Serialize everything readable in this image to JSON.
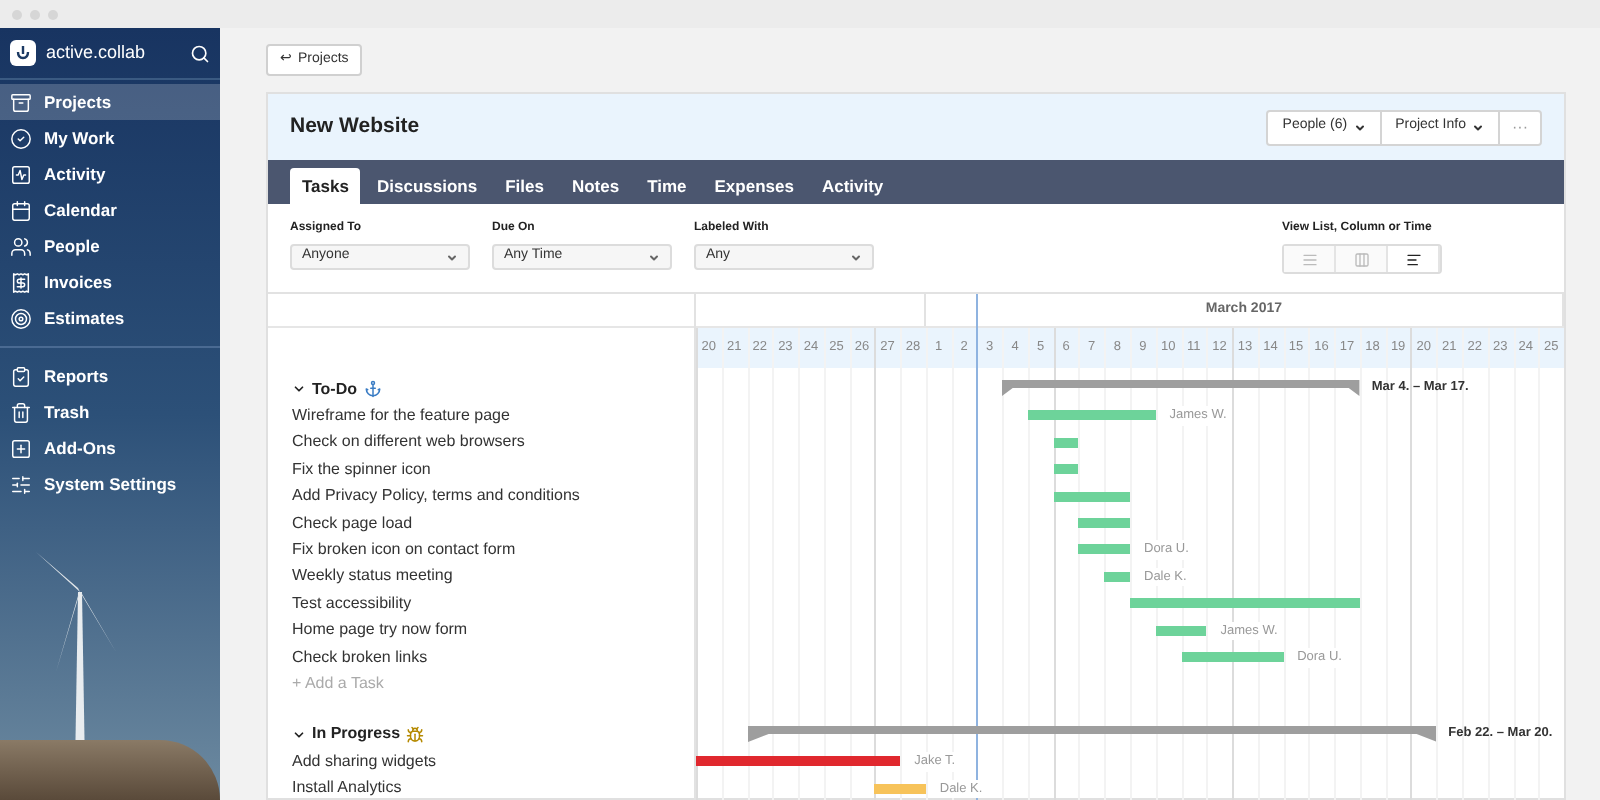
{
  "sidebar": {
    "brand": "active.collab",
    "groups": [
      {
        "items": [
          {
            "label": "Projects",
            "selected": true
          },
          {
            "label": "My Work",
            "selected": false
          },
          {
            "label": "Activity",
            "selected": false
          },
          {
            "label": "Calendar",
            "selected": false
          },
          {
            "label": "People",
            "selected": false
          },
          {
            "label": "Invoices",
            "selected": false
          },
          {
            "label": "Estimates",
            "selected": false
          }
        ]
      },
      {
        "items": [
          {
            "label": "Reports",
            "selected": false
          },
          {
            "label": "Trash",
            "selected": false
          },
          {
            "label": "Add-Ons",
            "selected": false
          },
          {
            "label": "System Settings",
            "selected": false
          }
        ]
      }
    ]
  },
  "back_button": {
    "icon": "↩",
    "label": "Projects"
  },
  "project": {
    "title": "New Website",
    "buttons": [
      "People (6)",
      "Project Info"
    ],
    "more": "···"
  },
  "tabs": [
    {
      "label": "Tasks",
      "selected": true
    },
    {
      "label": "Discussions",
      "selected": false
    },
    {
      "label": "Files",
      "selected": false
    },
    {
      "label": "Notes",
      "selected": false
    },
    {
      "label": "Time",
      "selected": false
    },
    {
      "label": "Expenses",
      "selected": false
    },
    {
      "label": "Activity",
      "selected": false
    }
  ],
  "filters": [
    {
      "label": "Assigned To",
      "value": "Anyone"
    },
    {
      "label": "Due On",
      "value": "Any Time"
    },
    {
      "label": "Labeled With",
      "value": "Any"
    }
  ],
  "view_switch": {
    "label": "View List, Column or Time",
    "options": [
      {
        "kind": "list",
        "selected": false
      },
      {
        "kind": "column",
        "selected": false
      },
      {
        "kind": "time",
        "selected": true
      }
    ]
  },
  "timeline": {
    "months": [
      {
        "days": [
          "20",
          "21",
          "22",
          "23",
          "24",
          "25",
          "26",
          "27",
          "28"
        ]
      },
      {
        "label": "March 2017",
        "days": [
          "1",
          "2",
          "3",
          "4",
          "5",
          "6",
          "7",
          "8",
          "9",
          "10",
          "11",
          "12",
          "13",
          "14",
          "15",
          "16",
          "17",
          "18",
          "19",
          "20",
          "21",
          "22",
          "23",
          "24",
          "25"
        ]
      }
    ]
  },
  "task_lists": [
    {
      "name": "To-Do",
      "kind": "anchor",
      "range": "Mar 4. – Mar 17.",
      "add_task": "+ Add a Task",
      "tasks": [
        {
          "name": "Wireframe for the feature page",
          "assignee": "James W.",
          "color": "#6dd39a"
        },
        {
          "name": "Check on different web browsers",
          "color": "#6dd39a"
        },
        {
          "name": "Fix the spinner icon",
          "color": "#6dd39a"
        },
        {
          "name": "Add Privacy Policy, terms and conditions",
          "color": "#6dd39a"
        },
        {
          "name": "Check page load",
          "color": "#6dd39a"
        },
        {
          "name": "Fix broken icon on contact form",
          "assignee": "Dora U.",
          "color": "#6dd39a"
        },
        {
          "name": "Weekly status meeting",
          "assignee": "Dale K.",
          "color": "#6dd39a"
        },
        {
          "name": "Test accessibility",
          "color": "#6dd39a"
        },
        {
          "name": "Home page try now form",
          "assignee": "James W.",
          "color": "#6dd39a"
        },
        {
          "name": "Check broken links",
          "assignee": "Dora U.",
          "color": "#6dd39a"
        }
      ]
    },
    {
      "name": "In Progress",
      "kind": "bee",
      "range": "Feb 22. – Mar 20.",
      "tasks": [
        {
          "name": "Add sharing widgets",
          "assignee": "Jake T.",
          "color": "#e0282e"
        },
        {
          "name": "Install Analytics",
          "assignee": "Dale K.",
          "color": "#f7c35a"
        }
      ]
    }
  ]
}
